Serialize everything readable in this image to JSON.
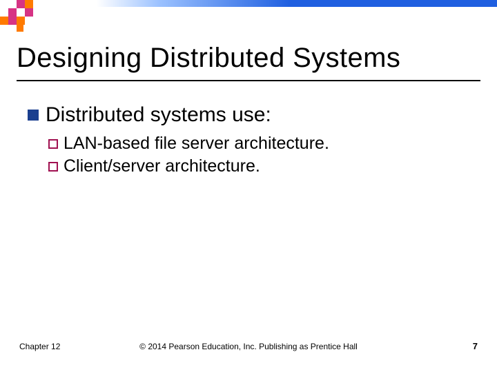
{
  "title": "Designing Distributed Systems",
  "bullets": {
    "level1": "Distributed systems use:",
    "subitems": [
      "LAN-based file server architecture.",
      "Client/server architecture."
    ]
  },
  "footer": {
    "chapter": "Chapter 12",
    "copyright": "© 2014 Pearson Education, Inc. Publishing as Prentice Hall",
    "page": "7"
  }
}
